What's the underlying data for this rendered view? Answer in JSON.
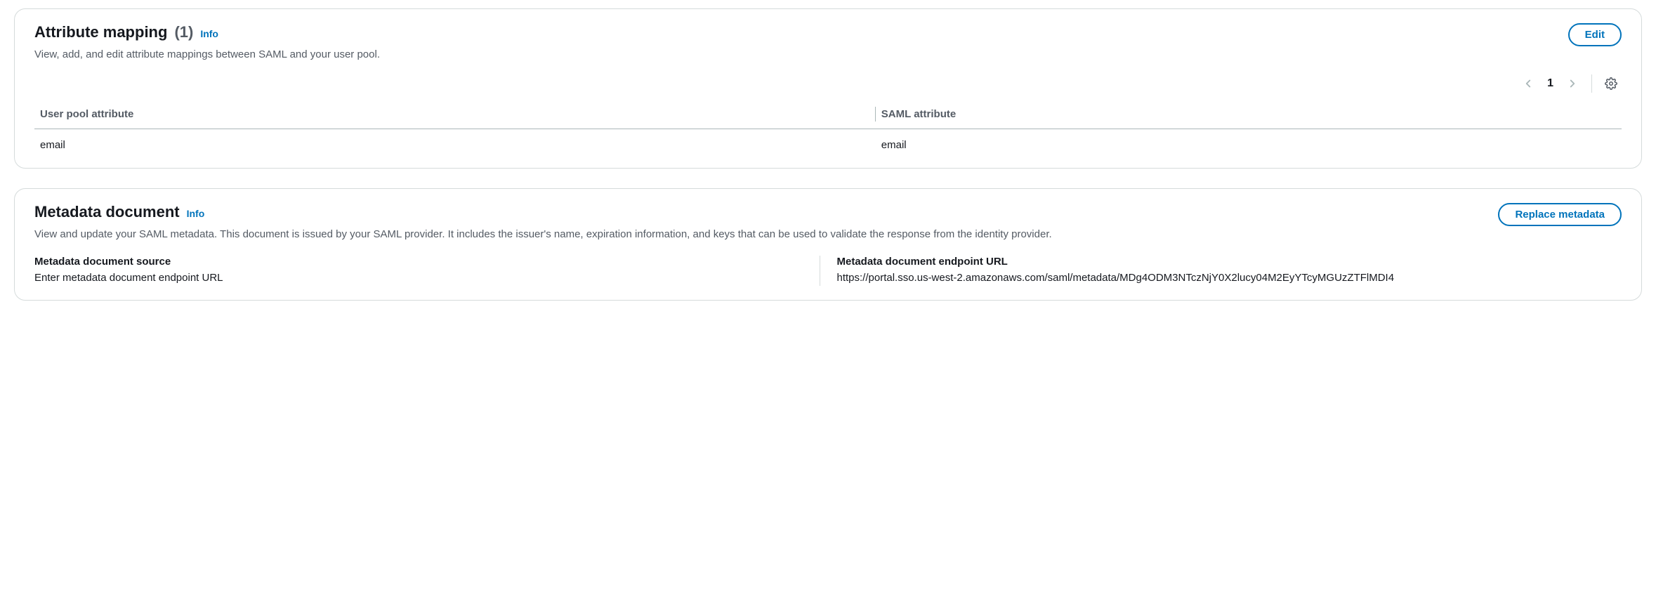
{
  "attribute_mapping": {
    "title": "Attribute mapping",
    "count": "(1)",
    "info": "Info",
    "edit": "Edit",
    "description": "View, add, and edit attribute mappings between SAML and your user pool.",
    "page": "1",
    "columns": {
      "user_pool": "User pool attribute",
      "saml": "SAML attribute"
    },
    "row": {
      "user_pool": "email",
      "saml": "email"
    }
  },
  "metadata_document": {
    "title": "Metadata document",
    "info": "Info",
    "replace": "Replace metadata",
    "description": "View and update your SAML metadata. This document is issued by your SAML provider. It includes the issuer's name, expiration information, and keys that can be used to validate the response from the identity provider.",
    "source_label": "Metadata document source",
    "source_value": "Enter metadata document endpoint URL",
    "endpoint_label": "Metadata document endpoint URL",
    "endpoint_value": "https://portal.sso.us-west-2.amazonaws.com/saml/metadata/MDg4ODM3NTczNjY0X2lucy04M2EyYTcyMGUzZTFlMDI4"
  }
}
